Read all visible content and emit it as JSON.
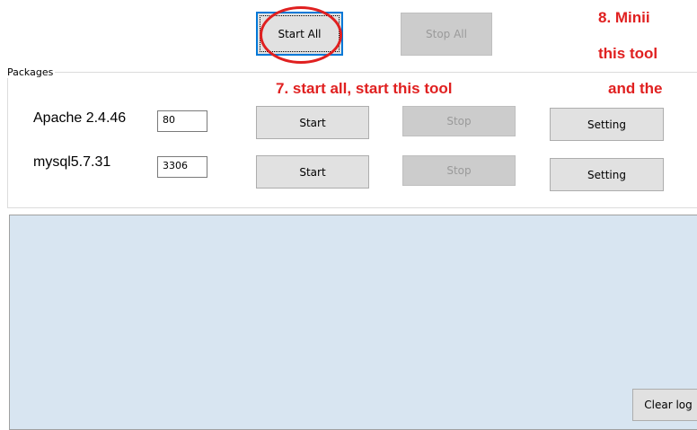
{
  "toolbar": {
    "start_all_label": "Start All",
    "stop_all_label": "Stop All"
  },
  "packages": {
    "group_title": "Packages",
    "rows": [
      {
        "name": "Apache 2.4.46",
        "port": "80",
        "start_label": "Start",
        "stop_label": "Stop",
        "setting_label": "Setting"
      },
      {
        "name": "mysql5.7.31",
        "port": "3306",
        "start_label": "Start",
        "stop_label": "Stop",
        "setting_label": "Setting"
      }
    ]
  },
  "log": {
    "clear_label": "Clear log"
  },
  "annotations": {
    "step7": "7. start all, start this tool",
    "step8_line1": "8.  Minii",
    "step8_line2": "this tool",
    "step8_line3": "and the",
    "color": "#e02020"
  }
}
